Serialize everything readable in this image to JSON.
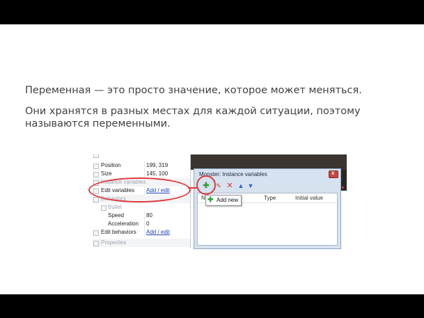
{
  "slide": {
    "paragraph1": "Переменная — это просто значение, которое может меняться.",
    "paragraph2": "Они хранятся в разных местах для каждой ситуации, поэтому называются переменными."
  },
  "properties": {
    "position_label": "Position",
    "position_value": "199, 319",
    "size_label": "Size",
    "size_value": "145, 100",
    "instance_variables_header": "Instance variables",
    "edit_variables_label": "Edit variables",
    "edit_variables_link": "Add / edit",
    "behaviors_header": "Behaviors",
    "bullet_header": "Bullet",
    "speed_label": "Speed",
    "speed_value": "80",
    "acceleration_label": "Acceleration",
    "acceleration_value": "0",
    "edit_behaviors_label": "Edit behaviors",
    "edit_behaviors_link": "Add / edit",
    "properties_header": "Properties"
  },
  "dialog": {
    "title": "Monster: Instance variables",
    "columns": [
      "Name",
      "Type",
      "Initial value"
    ],
    "tooltip": "Add new"
  },
  "colors": {
    "annotation_red": "#e0383a",
    "add_green": "#2f9e2f"
  },
  "icons": {
    "add": "plus-icon",
    "edit": "pencil-icon",
    "delete": "cross-icon",
    "move_up": "arrow-up-icon",
    "move_down": "arrow-down-icon"
  }
}
